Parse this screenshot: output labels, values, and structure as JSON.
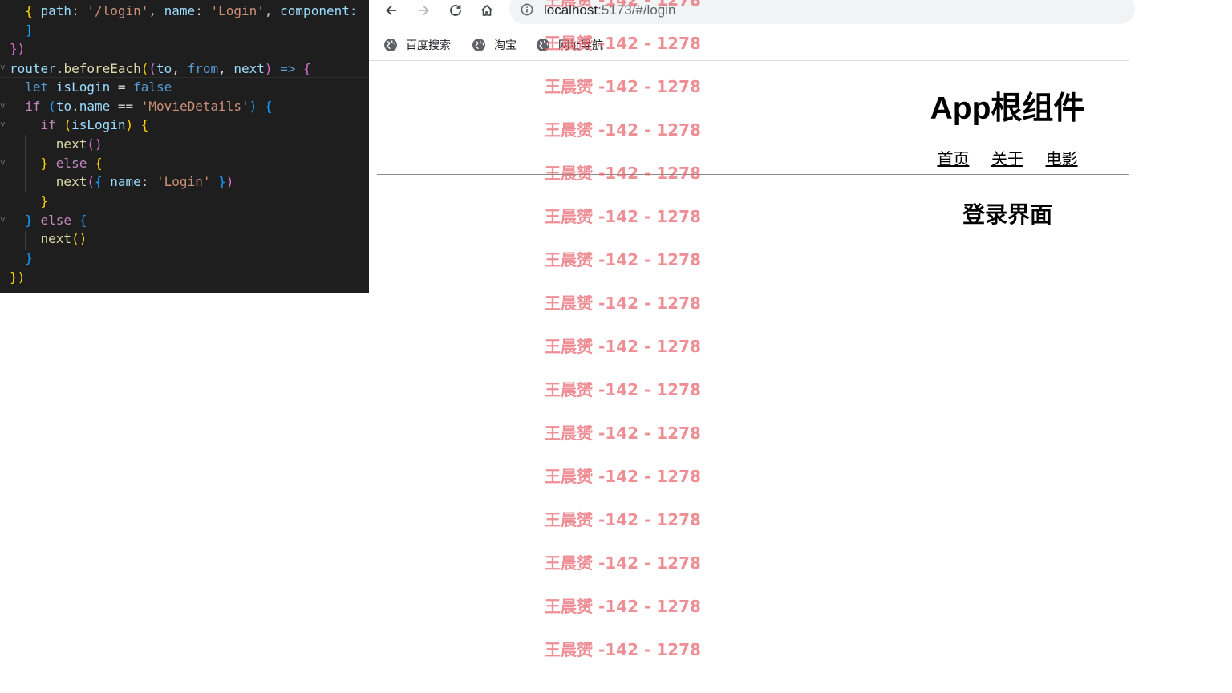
{
  "editor": {
    "lines": [
      [
        [
          "  ",
          "t-op"
        ],
        [
          "{ ",
          "t-b1"
        ],
        [
          "path",
          "t-var"
        ],
        [
          ": ",
          "t-op"
        ],
        [
          "'/login'",
          "t-str"
        ],
        [
          ", ",
          "t-op"
        ],
        [
          "name",
          "t-var"
        ],
        [
          ": ",
          "t-op"
        ],
        [
          "'Login'",
          "t-str"
        ],
        [
          ", ",
          "t-op"
        ],
        [
          "component:",
          "t-var"
        ]
      ],
      [
        [
          "  ",
          "t-op"
        ],
        [
          "]",
          "t-b3"
        ]
      ],
      [
        [
          "})",
          "t-b2"
        ]
      ],
      [
        [
          "router",
          "t-var"
        ],
        [
          ".",
          "t-op"
        ],
        [
          "beforeEach",
          "t-fn"
        ],
        [
          "(",
          "t-b1"
        ],
        [
          "(",
          "t-b2"
        ],
        [
          "to",
          "t-param"
        ],
        [
          ", ",
          "t-op"
        ],
        [
          "from",
          "t-kw"
        ],
        [
          ", ",
          "t-op"
        ],
        [
          "next",
          "t-param"
        ],
        [
          ")",
          "t-b2"
        ],
        [
          " => ",
          "t-kw"
        ],
        [
          "{",
          "t-b2"
        ]
      ],
      [
        [
          "  ",
          "t-op"
        ],
        [
          "let ",
          "t-kw"
        ],
        [
          "isLogin",
          "t-var"
        ],
        [
          " = ",
          "t-op"
        ],
        [
          "false",
          "t-kw"
        ]
      ],
      [
        [
          "  ",
          "t-op"
        ],
        [
          "if ",
          "t-ctl"
        ],
        [
          "(",
          "t-b3"
        ],
        [
          "to",
          "t-var"
        ],
        [
          ".",
          "t-op"
        ],
        [
          "name",
          "t-var"
        ],
        [
          " == ",
          "t-op"
        ],
        [
          "'MovieDetails'",
          "t-str"
        ],
        [
          ") ",
          "t-b3"
        ],
        [
          "{",
          "t-b3"
        ]
      ],
      [
        [
          "    ",
          "t-op"
        ],
        [
          "if ",
          "t-ctl"
        ],
        [
          "(",
          "t-b1"
        ],
        [
          "isLogin",
          "t-var"
        ],
        [
          ") ",
          "t-b1"
        ],
        [
          "{",
          "t-b1"
        ]
      ],
      [
        [
          "      ",
          "t-op"
        ],
        [
          "next",
          "t-fn"
        ],
        [
          "()",
          "t-b2"
        ]
      ],
      [
        [
          "    ",
          "t-op"
        ],
        [
          "} ",
          "t-b1"
        ],
        [
          "else ",
          "t-ctl"
        ],
        [
          "{",
          "t-b1"
        ]
      ],
      [
        [
          "      ",
          "t-op"
        ],
        [
          "next",
          "t-fn"
        ],
        [
          "(",
          "t-b2"
        ],
        [
          "{ ",
          "t-b3"
        ],
        [
          "name",
          "t-var"
        ],
        [
          ": ",
          "t-op"
        ],
        [
          "'Login'",
          "t-str"
        ],
        [
          " }",
          "t-b3"
        ],
        [
          ")",
          "t-b2"
        ]
      ],
      [
        [
          "    ",
          "t-op"
        ],
        [
          "}",
          "t-b1"
        ]
      ],
      [
        [
          "  ",
          "t-op"
        ],
        [
          "} ",
          "t-b3"
        ],
        [
          "else ",
          "t-ctl"
        ],
        [
          "{",
          "t-b3"
        ]
      ],
      [
        [
          "    ",
          "t-op"
        ],
        [
          "next",
          "t-fn"
        ],
        [
          "()",
          "t-b1"
        ]
      ],
      [
        [
          "  ",
          "t-op"
        ],
        [
          "}",
          "t-b3"
        ]
      ],
      [
        [
          "})",
          "t-b1"
        ]
      ]
    ]
  },
  "browser": {
    "url_host": "localhost",
    "url_rest": ":5173/#/login",
    "bookmarks": [
      "百度搜索",
      "淘宝",
      "网址导航"
    ]
  },
  "app": {
    "title": "App根组件",
    "nav": [
      "首页",
      "关于",
      "电影"
    ],
    "view_title": "登录界面"
  },
  "watermark": {
    "text": "王晨赟 -142 - 1278",
    "repeat": 16
  }
}
